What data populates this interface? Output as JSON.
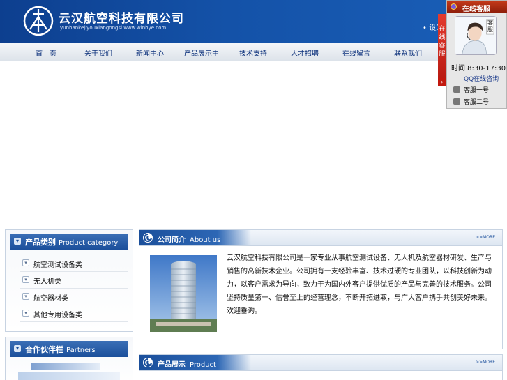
{
  "header": {
    "company_name": "云汉航空科技有限公司",
    "company_pinyin": "yunhankejiyouxiangongsi  www.winhye.com",
    "top_link": "• 设为首页"
  },
  "nav": {
    "items": [
      {
        "label": "首　页"
      },
      {
        "label": "关于我们"
      },
      {
        "label": "新闻中心"
      },
      {
        "label": "产品展示中"
      },
      {
        "label": "技术支持"
      },
      {
        "label": "人才招聘"
      },
      {
        "label": "在线留言"
      },
      {
        "label": "联系我们"
      }
    ]
  },
  "product_category": {
    "title": "产品类别",
    "title_en": "Product category",
    "items": [
      {
        "label": "航空测试设备类"
      },
      {
        "label": "无人机类"
      },
      {
        "label": "航空器材类"
      },
      {
        "label": "其他专用设备类"
      }
    ]
  },
  "partners": {
    "title": "合作伙伴栏",
    "title_en": "Partners"
  },
  "about": {
    "title": "公司简介",
    "title_en": "About us",
    "more": ">>MORE",
    "text": "云汉航空科技有限公司是一家专业从事航空测试设备、无人机及航空器材研发、生产与销售的高新技术企业。公司拥有一支经验丰富、技术过硬的专业团队，以科技创新为动力，以客户需求为导向，致力于为国内外客户提供优质的产品与完善的技术服务。公司坚持质量第一、信誉至上的经营理念，不断开拓进取，与广大客户携手共创美好未来。欢迎垂询。"
  },
  "products": {
    "title": "产品展示",
    "title_en": "Product",
    "more": ">>MORE"
  },
  "online_service": {
    "title": "在线客服",
    "tab_text": "在线客服",
    "tab_arrow": "›",
    "avatar_badge": "客服",
    "hours": "时间 8:30-17:30",
    "qq_label": "QQ在线咨询",
    "contacts": [
      {
        "label": "客服一号"
      },
      {
        "label": "客服二号"
      }
    ]
  },
  "colors": {
    "brand_blue": "#1452a8",
    "accent_red": "#c2180e"
  }
}
